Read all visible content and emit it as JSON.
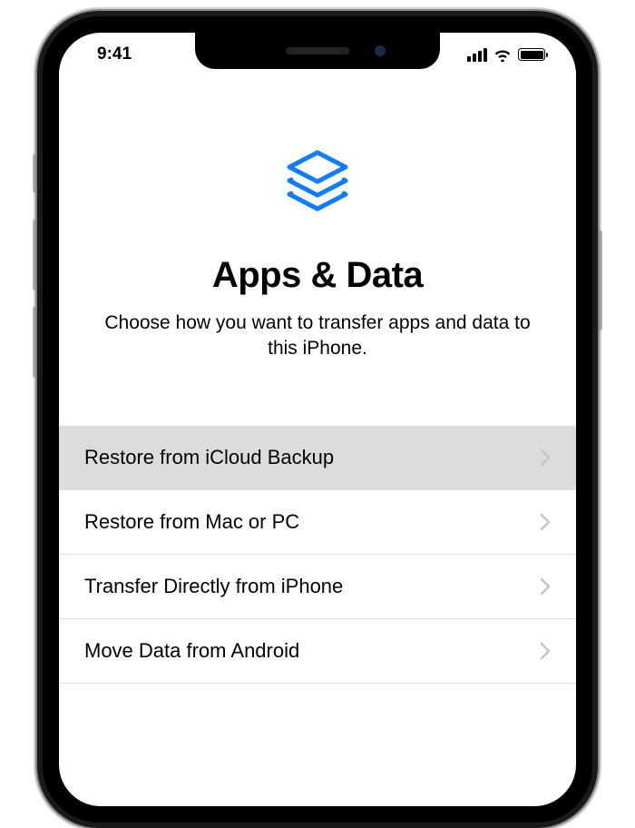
{
  "status_bar": {
    "time": "9:41"
  },
  "screen": {
    "title": "Apps & Data",
    "subtitle": "Choose how you want to transfer apps and data to this iPhone.",
    "icon": "layers-stack-icon",
    "options": [
      {
        "label": "Restore from iCloud Backup",
        "selected": true
      },
      {
        "label": "Restore from Mac or PC",
        "selected": false
      },
      {
        "label": "Transfer Directly from iPhone",
        "selected": false
      },
      {
        "label": "Move Data from Android",
        "selected": false
      }
    ]
  },
  "colors": {
    "accent": "#127CFF",
    "chevron": "#c5c5c7",
    "selected_bg": "#dcdcde"
  }
}
